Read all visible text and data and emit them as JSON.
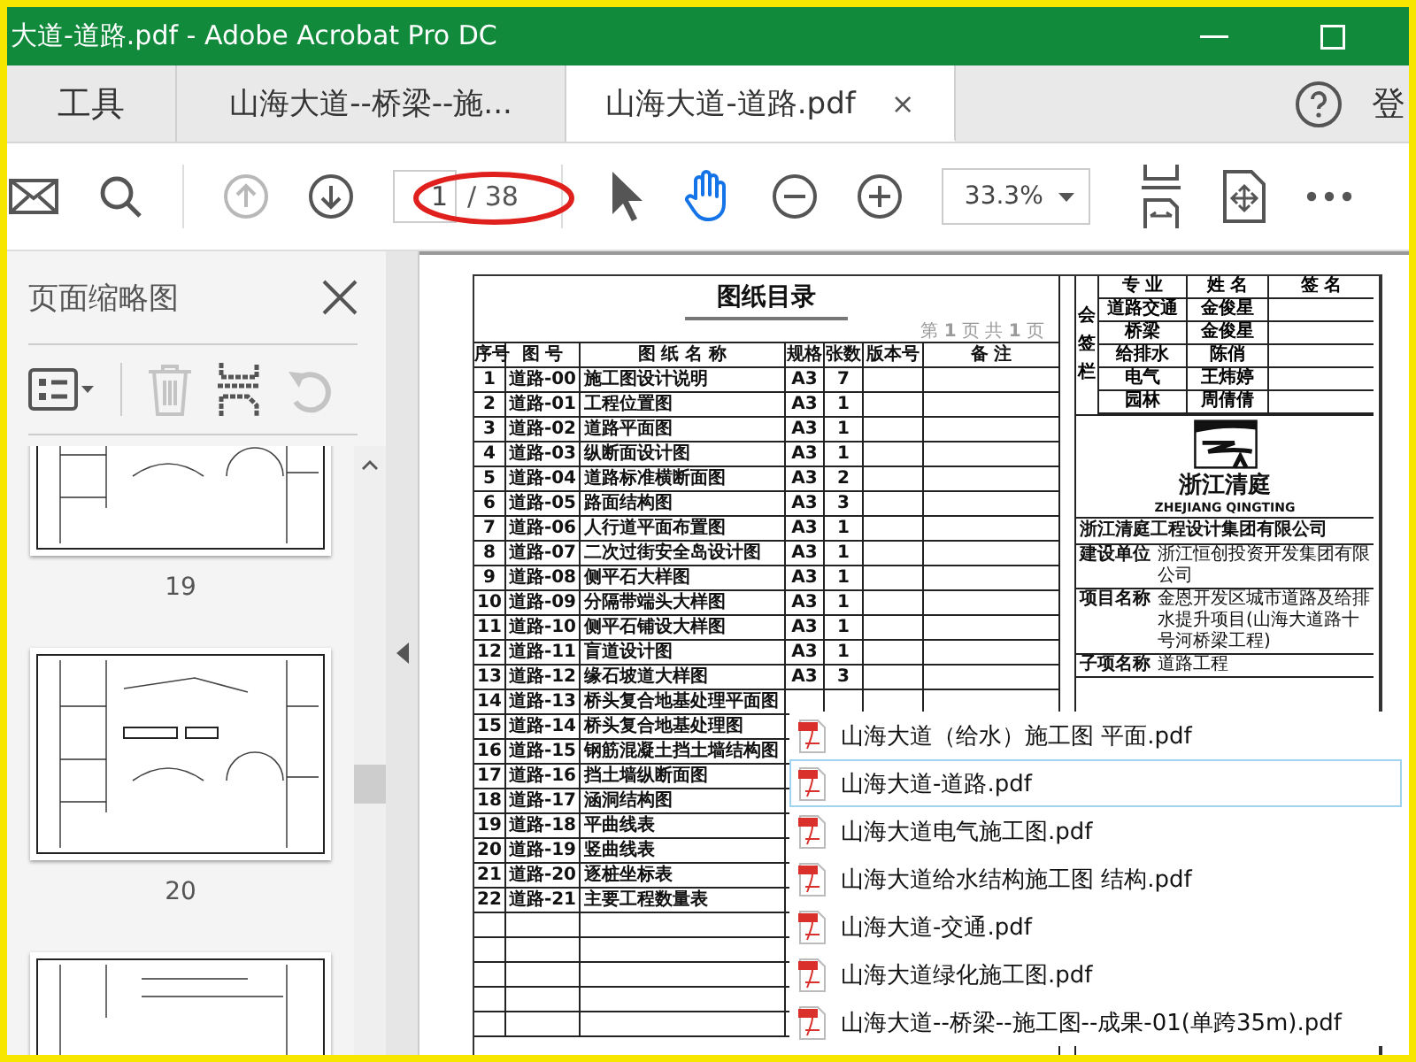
{
  "window": {
    "title": "大道-道路.pdf - Adobe Acrobat Pro DC"
  },
  "tabs": [
    {
      "label": "工具",
      "kind": "tools",
      "selected": false
    },
    {
      "label": "山海大道--桥梁--施...",
      "kind": "document",
      "selected": false
    },
    {
      "label": "山海大道-道路.pdf",
      "kind": "document",
      "selected": true,
      "close": "×"
    }
  ],
  "account": {
    "label": "登"
  },
  "toolbar": {
    "prev_page_disabled": true,
    "next_page_disabled": false,
    "page_value": "1",
    "page_total": "/ 38",
    "hand_tool_selected": true,
    "zoom_value": "33.3%"
  },
  "thumbnail_panel": {
    "title": "页面缩略图",
    "delete_disabled": true,
    "rotate_disabled": true,
    "thumbnails": [
      {
        "page": "19"
      },
      {
        "page": "20"
      }
    ]
  },
  "drawing_index": {
    "title": "图纸目录",
    "page_note": "第 **1** 页 共 **1** 页",
    "columns": [
      "序号",
      "图 号",
      "图 纸 名 称",
      "规格",
      "张数",
      "版本号",
      "备 注"
    ],
    "rows": [
      {
        "no": "1",
        "code": "道路-00",
        "name": "施工图设计说明",
        "format": "A3",
        "sheets": "7"
      },
      {
        "no": "2",
        "code": "道路-01",
        "name": "工程位置图",
        "format": "A3",
        "sheets": "1"
      },
      {
        "no": "3",
        "code": "道路-02",
        "name": "道路平面图",
        "format": "A3",
        "sheets": "1"
      },
      {
        "no": "4",
        "code": "道路-03",
        "name": "纵断面设计图",
        "format": "A3",
        "sheets": "1"
      },
      {
        "no": "5",
        "code": "道路-04",
        "name": "道路标准横断面图",
        "format": "A3",
        "sheets": "2"
      },
      {
        "no": "6",
        "code": "道路-05",
        "name": "路面结构图",
        "format": "A3",
        "sheets": "3"
      },
      {
        "no": "7",
        "code": "道路-06",
        "name": "人行道平面布置图",
        "format": "A3",
        "sheets": "1"
      },
      {
        "no": "8",
        "code": "道路-07",
        "name": "二次过街安全岛设计图",
        "format": "A3",
        "sheets": "1"
      },
      {
        "no": "9",
        "code": "道路-08",
        "name": "侧平石大样图",
        "format": "A3",
        "sheets": "1"
      },
      {
        "no": "10",
        "code": "道路-09",
        "name": "分隔带端头大样图",
        "format": "A3",
        "sheets": "1"
      },
      {
        "no": "11",
        "code": "道路-10",
        "name": "侧平石铺设大样图",
        "format": "A3",
        "sheets": "1"
      },
      {
        "no": "12",
        "code": "道路-11",
        "name": "盲道设计图",
        "format": "A3",
        "sheets": "1"
      },
      {
        "no": "13",
        "code": "道路-12",
        "name": "缘石坡道大样图",
        "format": "A3",
        "sheets": "3"
      },
      {
        "no": "14",
        "code": "道路-13",
        "name": "桥头复合地基处理平面图"
      },
      {
        "no": "15",
        "code": "道路-14",
        "name": "桥头复合地基处理图"
      },
      {
        "no": "16",
        "code": "道路-15",
        "name": "钢筋混凝土挡土墙结构图"
      },
      {
        "no": "17",
        "code": "道路-16",
        "name": "挡土墙纵断面图"
      },
      {
        "no": "18",
        "code": "道路-17",
        "name": "涵洞结构图"
      },
      {
        "no": "19",
        "code": "道路-18",
        "name": "平曲线表"
      },
      {
        "no": "20",
        "code": "道路-19",
        "name": "竖曲线表"
      },
      {
        "no": "21",
        "code": "道路-20",
        "name": "逐桩坐标表"
      },
      {
        "no": "22",
        "code": "道路-21",
        "name": "主要工程数量表"
      }
    ]
  },
  "title_block": {
    "sign_label": "会签栏",
    "sign_columns": [
      "专 业",
      "姓 名",
      "签 名"
    ],
    "sign_rows": [
      {
        "discipline": "道路交通",
        "name": "金俊星"
      },
      {
        "discipline": "桥梁",
        "name": "金俊星"
      },
      {
        "discipline": "给排水",
        "name": "陈俏"
      },
      {
        "discipline": "电气",
        "name": "王炜婷"
      },
      {
        "discipline": "园林",
        "name": "周倩倩"
      }
    ],
    "logo_name": "浙江清庭",
    "logo_pinyin": "ZHEJIANG QINGTING",
    "company": "浙江清庭工程设计集团有限公司",
    "client_label": "建设单位",
    "client": "浙江恒创投资开发集团有限公司",
    "project_label": "项目名称",
    "project": "金恩开发区城市道路及给排水提升项目(山海大道路十号河桥梁工程)",
    "subitem_label": "子项名称",
    "subitem": "道路工程"
  },
  "file_list": [
    {
      "name": "山海大道（给水）施工图 平面.pdf",
      "selected": false
    },
    {
      "name": "山海大道-道路.pdf",
      "selected": true
    },
    {
      "name": "山海大道电气施工图.pdf",
      "selected": false
    },
    {
      "name": "山海大道给水结构施工图 结构.pdf",
      "selected": false
    },
    {
      "name": "山海大道-交通.pdf",
      "selected": false
    },
    {
      "name": "山海大道绿化施工图.pdf",
      "selected": false
    },
    {
      "name": "山海大道--桥梁--施工图--成果-01(单跨35m).pdf",
      "selected": false
    }
  ]
}
